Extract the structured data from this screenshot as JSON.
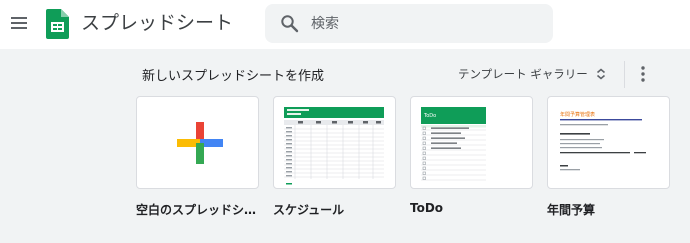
{
  "header": {
    "app_name": "スプレッドシート",
    "search_placeholder": "検索"
  },
  "gallery": {
    "title": "新しいスプレッドシートを作成",
    "toggle_label": "テンプレート ギャラリー",
    "templates": [
      {
        "label": "空白のスプレッドシート"
      },
      {
        "label": "スケジュール"
      },
      {
        "label": "ToDo",
        "thumb_title": "ToDo"
      },
      {
        "label": "年間予算",
        "thumb_title": "年間予算管理表"
      }
    ]
  },
  "colors": {
    "sheets_green": "#0f9d58",
    "blank_plus": [
      "#ea4335",
      "#fbbc04",
      "#4285f4",
      "#34a853"
    ],
    "budget_title": "#e8710a",
    "budget_rule": "#3c4a9c"
  },
  "icons": [
    "menu-icon",
    "sheets-logo-icon",
    "search-icon",
    "unfold-icon",
    "more-vert-icon",
    "plus-icon"
  ]
}
